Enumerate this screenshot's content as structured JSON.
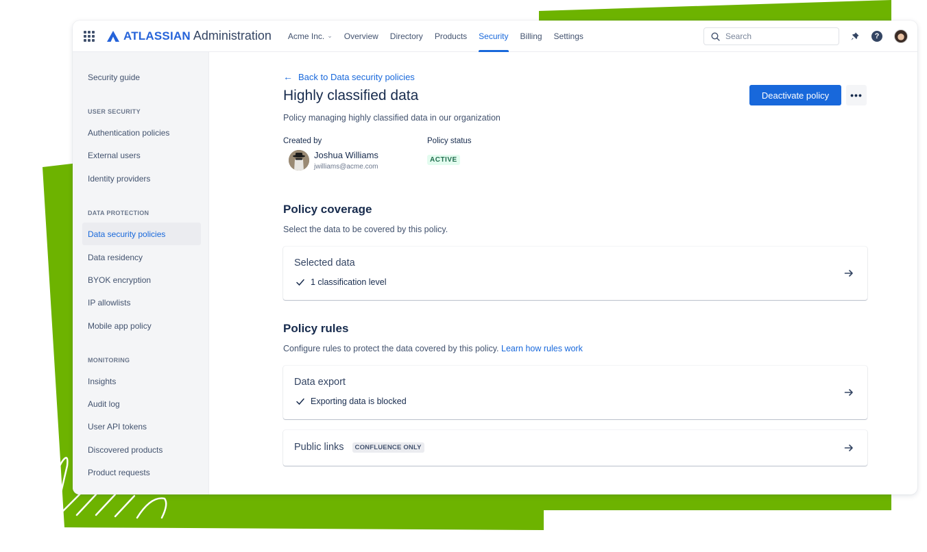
{
  "app": {
    "brand": "ATLASSIAN",
    "product": "Administration",
    "brand_color": "#2563d9",
    "accent_color": "#1868DB"
  },
  "topnav": {
    "org": "Acme Inc.",
    "items": [
      {
        "label": "Overview",
        "active": false
      },
      {
        "label": "Directory",
        "active": false
      },
      {
        "label": "Products",
        "active": false
      },
      {
        "label": "Security",
        "active": true
      },
      {
        "label": "Billing",
        "active": false
      },
      {
        "label": "Settings",
        "active": false
      }
    ],
    "search_placeholder": "Search",
    "icons": [
      "app-switcher-icon",
      "notifications-icon",
      "help-icon",
      "user-avatar"
    ]
  },
  "sidebar": {
    "top_item": "Security guide",
    "sections": [
      {
        "heading": "USER SECURITY",
        "items": [
          "Authentication policies",
          "External users",
          "Identity providers"
        ]
      },
      {
        "heading": "DATA PROTECTION",
        "items": [
          "Data security policies",
          "Data residency",
          "BYOK encryption",
          "IP allowlists",
          "Mobile app policy"
        ]
      },
      {
        "heading": "MONITORING",
        "items": [
          "Insights",
          "Audit log",
          "User API tokens",
          "Discovered products",
          "Product requests"
        ]
      }
    ],
    "active_item": "Data security policies"
  },
  "page": {
    "back_link": "Back to Data security policies",
    "title": "Highly classified data",
    "description": "Policy managing highly classified data in our organization",
    "deactivate_label": "Deactivate policy",
    "more_label": "•••",
    "created_by_label": "Created by",
    "creator_name": "Joshua Williams",
    "creator_email": "jwilliams@acme.com",
    "policy_status_label": "Policy status",
    "policy_status": "ACTIVE"
  },
  "coverage": {
    "title": "Policy coverage",
    "description": "Select the data to be covered by this policy.",
    "card_title": "Selected data",
    "card_detail": "1 classification level"
  },
  "rules": {
    "title": "Policy rules",
    "description": "Configure rules to protect the data covered by this policy.",
    "learn_link": "Learn how rules work",
    "cards": [
      {
        "title": "Data export",
        "detail": "Exporting data is blocked"
      },
      {
        "title": "Public links",
        "badge": "CONFLUENCE ONLY"
      }
    ]
  }
}
